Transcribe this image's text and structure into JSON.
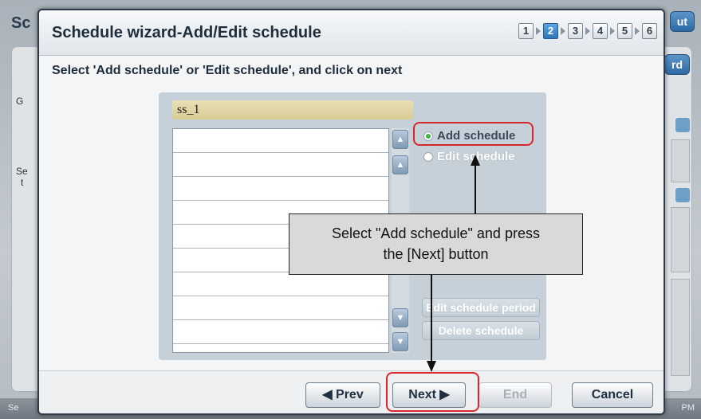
{
  "background": {
    "title": "Sc",
    "top_button": "ut",
    "second_button": "rd",
    "side_g": "G",
    "side_se": "Se",
    "side_t": "t",
    "status_left": "Se",
    "status_right": "PM"
  },
  "dialog": {
    "title": "Schedule wizard-Add/Edit schedule",
    "steps": [
      "1",
      "2",
      "3",
      "4",
      "5",
      "6"
    ],
    "active_step": "2",
    "instruction": "Select 'Add schedule' or 'Edit schedule', and click on next",
    "schedule_name": "ss_1",
    "options": {
      "add": "Add schedule",
      "edit": "Edit schedule",
      "selected": "Add schedule"
    },
    "side_buttons": {
      "edit_period": "Edit schedule period",
      "delete": "Delete schedule"
    },
    "footer": {
      "prev": "◀ Prev",
      "next": "Next ▶",
      "end": "End",
      "cancel": "Cancel"
    }
  },
  "callout": {
    "line1": "Select \"Add schedule\" and press",
    "line2": "the [Next] button"
  },
  "colors": {
    "highlight": "#d9262b",
    "active_step": "#2c77bb",
    "radio_on": "#3fb34a"
  }
}
